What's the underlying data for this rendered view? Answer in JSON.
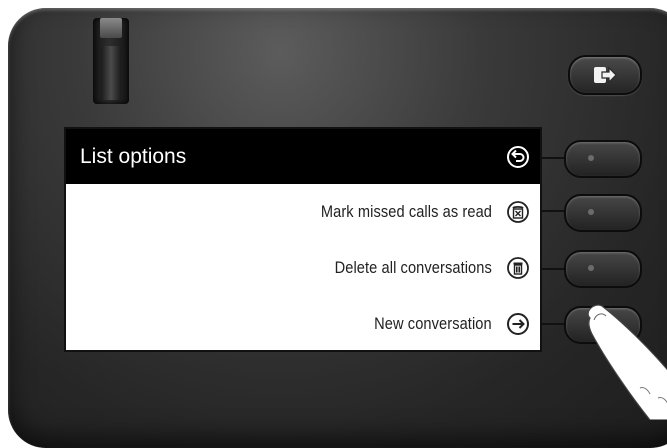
{
  "screen": {
    "title": "List options",
    "back_icon": "back-arrow-icon",
    "items": [
      {
        "label": "Mark missed calls as read",
        "icon": "mark-read-icon"
      },
      {
        "label": "Delete all conversations",
        "icon": "trash-icon"
      },
      {
        "label": "New conversation",
        "icon": "arrow-right-icon"
      }
    ]
  },
  "device": {
    "exit_key_icon": "exit-icon"
  },
  "colors": {
    "header_bg": "#000000",
    "header_text": "#ffffff",
    "screen_bg": "#ffffff",
    "device_body": "#2a2a2a"
  }
}
